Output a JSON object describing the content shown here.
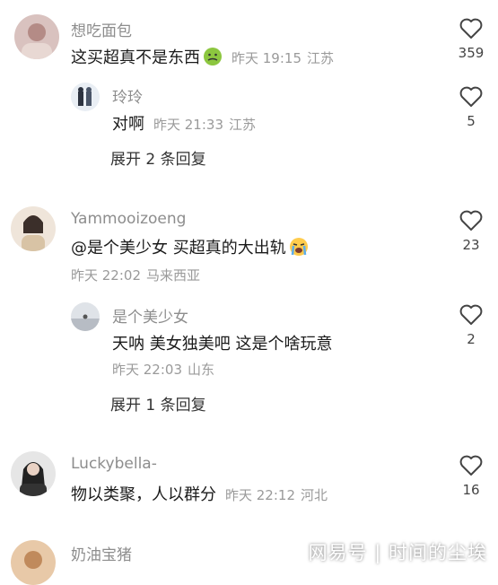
{
  "colors": {
    "name": "#8d8d8d",
    "text": "#1b1b1b",
    "meta": "#9a9a9a",
    "heart": "#444444"
  },
  "comments": [
    {
      "user": "想吃面包",
      "text": "这买超真不是东西",
      "time": "昨天 19:15",
      "location": "江苏",
      "likes": "359",
      "emoji": "nauseated-face"
    },
    {
      "user": "玲玲",
      "text": "对啊",
      "time": "昨天 21:33",
      "location": "江苏",
      "likes": "5"
    },
    {
      "expand": "展开 2 条回复"
    },
    {
      "user": "Yammooizoeng",
      "text": "@是个美少女  买超真的大出轨",
      "time": "昨天 22:02",
      "location": "马来西亚",
      "likes": "23",
      "emoji": "crying-face"
    },
    {
      "user": "是个美少女",
      "text": "天呐 美女独美吧 这是个啥玩意",
      "time": "昨天 22:03",
      "location": "山东",
      "likes": "2"
    },
    {
      "expand": "展开 1 条回复"
    },
    {
      "user": "Luckybella-",
      "text": "物以类聚，人以群分",
      "time": "昨天 22:12",
      "location": "河北",
      "likes": "16"
    },
    {
      "user": "奶油宝猪"
    }
  ],
  "watermark": "网易号 | 时间的尘埃"
}
